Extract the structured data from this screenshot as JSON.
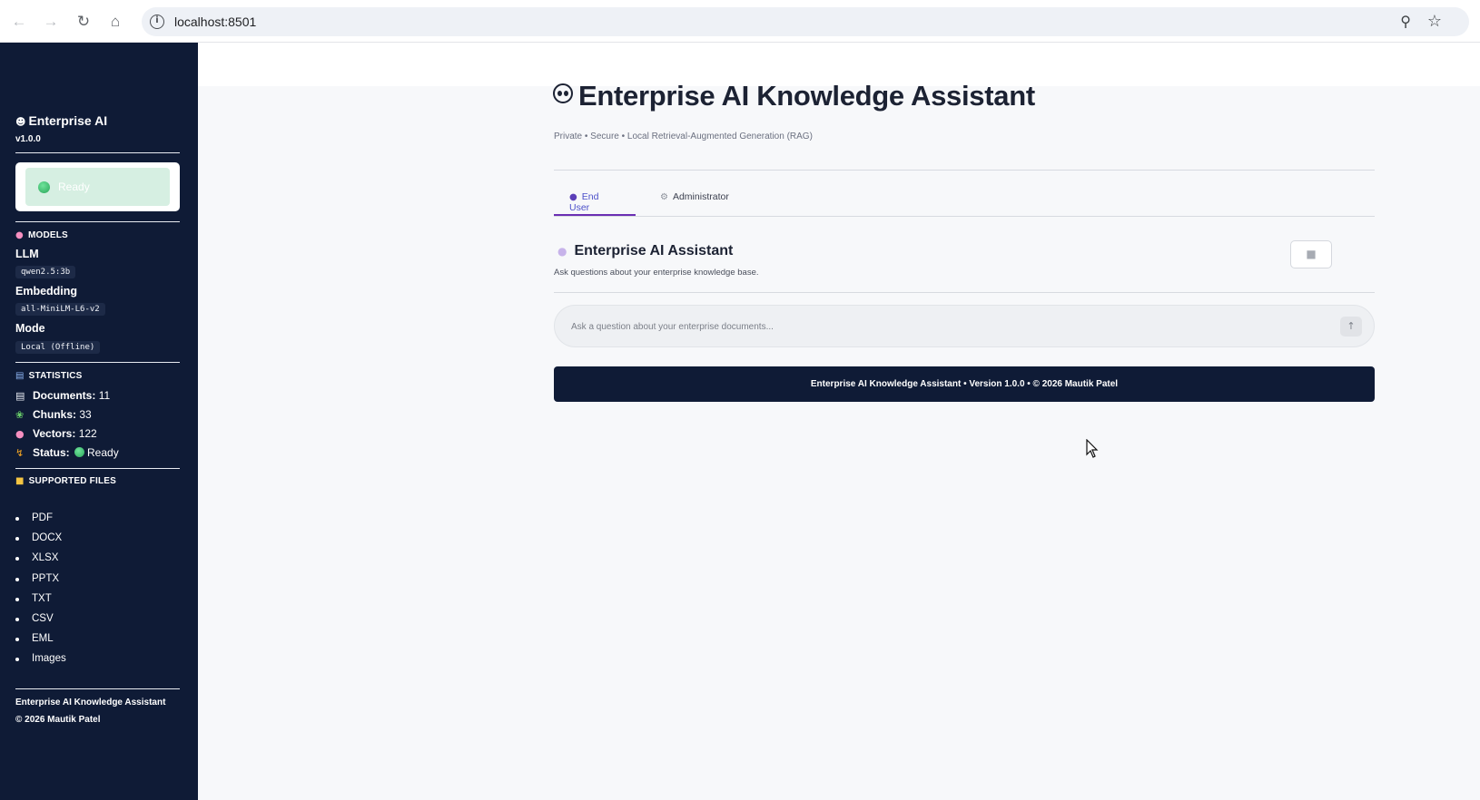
{
  "browser": {
    "url": "localhost:8501",
    "icons": {
      "back": "back-arrow-icon",
      "forward": "forward-arrow-icon",
      "reload": "reload-icon",
      "home": "home-icon",
      "info": "info-icon",
      "zoom": "zoom-icon",
      "bookmark": "star-icon"
    }
  },
  "sidebar": {
    "brand": "Enterprise AI",
    "version": "v1.0.0",
    "status_label": "Ready",
    "models": {
      "header": "MODELS",
      "llm_label": "LLM",
      "llm_value": "qwen2.5:3b",
      "embedding_label": "Embedding",
      "embedding_value": "all-MiniLM-L6-v2",
      "mode_label": "Mode",
      "mode_value": "Local (Offline)"
    },
    "statistics": {
      "header": "STATISTICS",
      "documents_label": "Documents:",
      "documents_value": "11",
      "chunks_label": "Chunks:",
      "chunks_value": "33",
      "vectors_label": "Vectors:",
      "vectors_value": "122",
      "status_label": "Status:",
      "status_value": "Ready"
    },
    "supported_files": {
      "header": "SUPPORTED FILES",
      "items": [
        "PDF",
        "DOCX",
        "XLSX",
        "PPTX",
        "TXT",
        "CSV",
        "EML",
        "Images"
      ]
    },
    "footer_line1": "Enterprise AI Knowledge Assistant",
    "footer_line2": "© 2026 Mautik Patel"
  },
  "main": {
    "title": "Enterprise AI Knowledge Assistant",
    "subtitle": "Private • Secure • Local Retrieval-Augmented Generation (RAG)",
    "tabs": [
      {
        "label": "End User",
        "active": true
      },
      {
        "label": "Administrator",
        "active": false
      }
    ],
    "chat": {
      "title": "Enterprise AI Assistant",
      "subtitle": "Ask questions about your enterprise knowledge base.",
      "input_placeholder": "Ask a question about your enterprise documents...",
      "input_value": ""
    },
    "footer": "Enterprise AI Knowledge Assistant  •  Version 1.0.0  •  © 2026 Mautik Patel"
  },
  "colors": {
    "sidebar_bg": "#0f1b36",
    "accent_tab": "#6b2fb3",
    "status_green": "#2aa65a",
    "page_bg": "#f7f8fa"
  }
}
